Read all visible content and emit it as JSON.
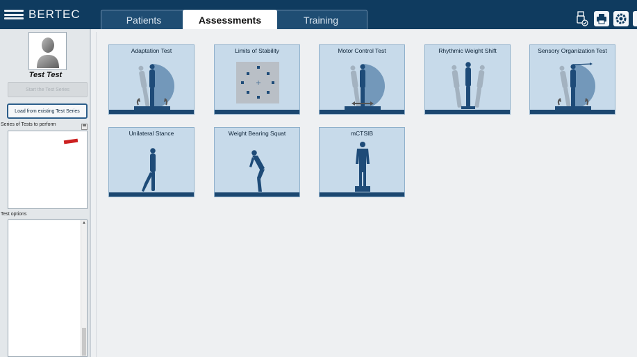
{
  "app": {
    "brand": "BERTEC"
  },
  "tabs": [
    {
      "label": "Patients",
      "active": false
    },
    {
      "label": "Assessments",
      "active": true
    },
    {
      "label": "Training",
      "active": false
    }
  ],
  "header_icons": [
    "usb-status-icon",
    "print-icon",
    "settings-icon"
  ],
  "sidebar": {
    "patient_name": "Test Test",
    "start_button": "Start the Test Series",
    "load_button": "Load from existing Test Series",
    "series_label": "Series of Tests to perform",
    "options_label": "Test options"
  },
  "assessments": [
    {
      "label": "Adaptation Test",
      "icon": "adaptation-test-icon"
    },
    {
      "label": "Limits of Stability",
      "icon": "limits-of-stability-icon"
    },
    {
      "label": "Motor Control Test",
      "icon": "motor-control-test-icon"
    },
    {
      "label": "Rhythmic Weight Shift",
      "icon": "rhythmic-weight-shift-icon"
    },
    {
      "label": "Sensory Organization Test",
      "icon": "sensory-organization-test-icon"
    },
    {
      "label": "Unilateral Stance",
      "icon": "unilateral-stance-icon"
    },
    {
      "label": "Weight Bearing Squat",
      "icon": "weight-bearing-squat-icon"
    },
    {
      "label": "mCTSIB",
      "icon": "mctsib-icon"
    }
  ],
  "colors": {
    "header": "#0f3b5f",
    "tile_bg": "#c7daea",
    "tile_dark": "#1b4770",
    "figure": "#1e4b78"
  }
}
